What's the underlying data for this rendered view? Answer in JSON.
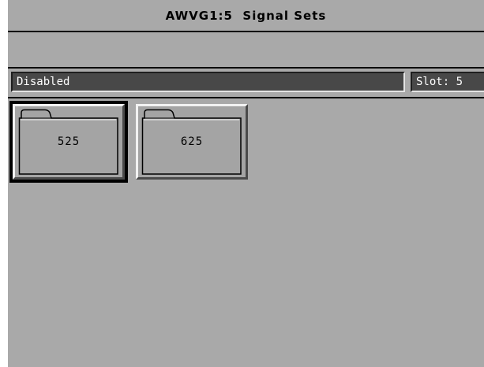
{
  "title": "AWVG1:5  Signal Sets",
  "status": {
    "state": "Disabled",
    "slot": "Slot: 5"
  },
  "folders": [
    {
      "label": "525",
      "selected": true
    },
    {
      "label": "625",
      "selected": false
    }
  ],
  "colors": {
    "background": "#a9a9a9",
    "field_background": "#484848",
    "field_text": "#ffffff"
  }
}
